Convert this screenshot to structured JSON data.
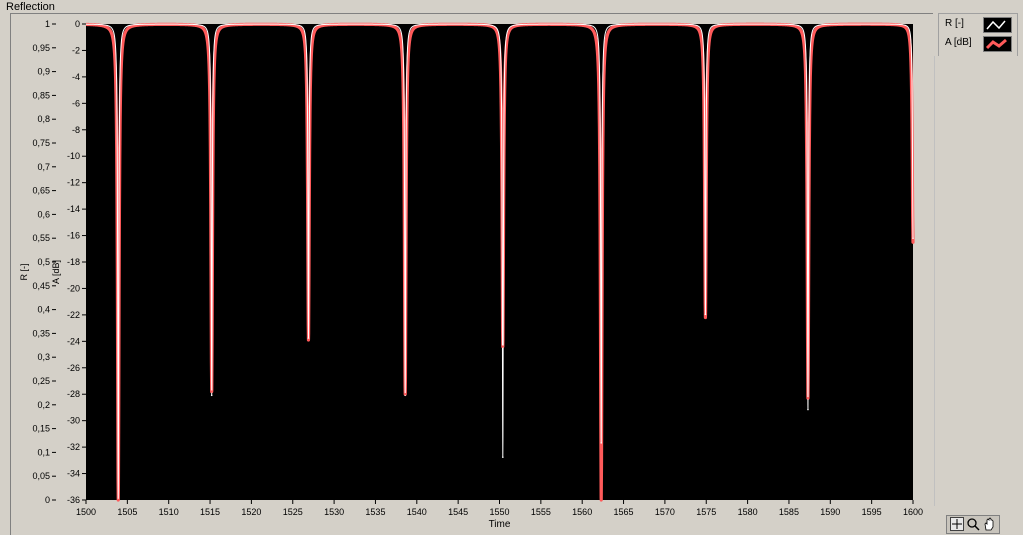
{
  "window": {
    "title": "Reflection"
  },
  "legend": {
    "items": [
      {
        "label": "R [-]",
        "color": "#ffffff"
      },
      {
        "label": "A [dB]",
        "color": "#ff5a5a"
      }
    ]
  },
  "palette": {
    "background": "#000000",
    "panel": "#d4d0c8",
    "grid": "#2a2a2a"
  },
  "tools": [
    "crosshair-icon",
    "zoom-icon",
    "pan-hand-icon"
  ],
  "chart_data": {
    "type": "line",
    "xlabel": "Time",
    "ylabel": "R [-]",
    "y2label": "A [dB]",
    "xlim": [
      1500,
      1600
    ],
    "ylim": [
      0,
      1
    ],
    "y2lim": [
      -36,
      0
    ],
    "xticks": [
      "1500",
      "1505",
      "1510",
      "1515",
      "1520",
      "1525",
      "1530",
      "1535",
      "1540",
      "1545",
      "1550",
      "1555",
      "1560",
      "1565",
      "1570",
      "1575",
      "1580",
      "1585",
      "1590",
      "1595",
      "1600"
    ],
    "yticks": [
      "0",
      "0,05",
      "0,1",
      "0,15",
      "0,2",
      "0,25",
      "0,3",
      "0,35",
      "0,4",
      "0,45",
      "0,5",
      "0,55",
      "0,6",
      "0,65",
      "0,7",
      "0,75",
      "0,8",
      "0,85",
      "0,9",
      "0,95",
      "1"
    ],
    "y2ticks": [
      "-36",
      "-34",
      "-32",
      "-30",
      "-28",
      "-26",
      "-24",
      "-22",
      "-20",
      "-18",
      "-16",
      "-14",
      "-12",
      "-10",
      "-8",
      "-6",
      "-4",
      "-2",
      "0"
    ],
    "series": [
      {
        "name": "R [-]",
        "axis": "left",
        "baseline": 1,
        "dips": [
          {
            "x": 1503.9,
            "min": 0.0
          },
          {
            "x": 1515.2,
            "min": 0.22
          },
          {
            "x": 1526.9,
            "min": 0.34
          },
          {
            "x": 1538.6,
            "min": 0.22
          },
          {
            "x": 1550.4,
            "min": 0.09
          },
          {
            "x": 1562.3,
            "min": 0.12
          },
          {
            "x": 1574.9,
            "min": 0.39
          },
          {
            "x": 1587.3,
            "min": 0.19
          },
          {
            "x": 1600.0,
            "min": 0.55
          }
        ]
      },
      {
        "name": "A [dB]",
        "axis": "right",
        "baseline": 0,
        "dips": [
          {
            "x": 1503.9,
            "min": -36
          },
          {
            "x": 1515.2,
            "min": -27.8
          },
          {
            "x": 1526.9,
            "min": -23.9
          },
          {
            "x": 1538.6,
            "min": -28
          },
          {
            "x": 1550.4,
            "min": -24.4
          },
          {
            "x": 1562.3,
            "min": -36
          },
          {
            "x": 1574.9,
            "min": -22.2
          },
          {
            "x": 1587.3,
            "min": -28.3
          },
          {
            "x": 1600.0,
            "min": -16.5
          }
        ]
      }
    ]
  }
}
